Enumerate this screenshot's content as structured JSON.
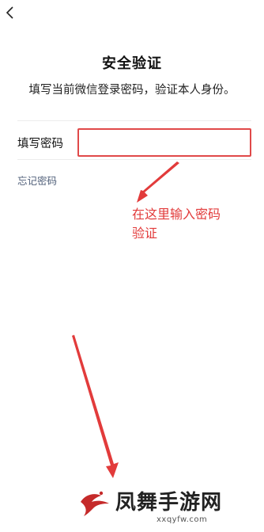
{
  "nav": {
    "back_icon": "chevron-left-icon"
  },
  "header": {
    "title": "安全验证",
    "subtitle": "填写当前微信登录密码，验证本人身份。"
  },
  "form": {
    "password_label": "填写密码",
    "password_value": "",
    "password_placeholder": "",
    "forgot_password": "忘记密码"
  },
  "annotation": {
    "note_line1": "在这里输入密码",
    "note_line2": "验证",
    "color": "#e23b3b"
  },
  "watermark": {
    "title": "凤舞手游网",
    "domain": "xxqyfw.com"
  }
}
